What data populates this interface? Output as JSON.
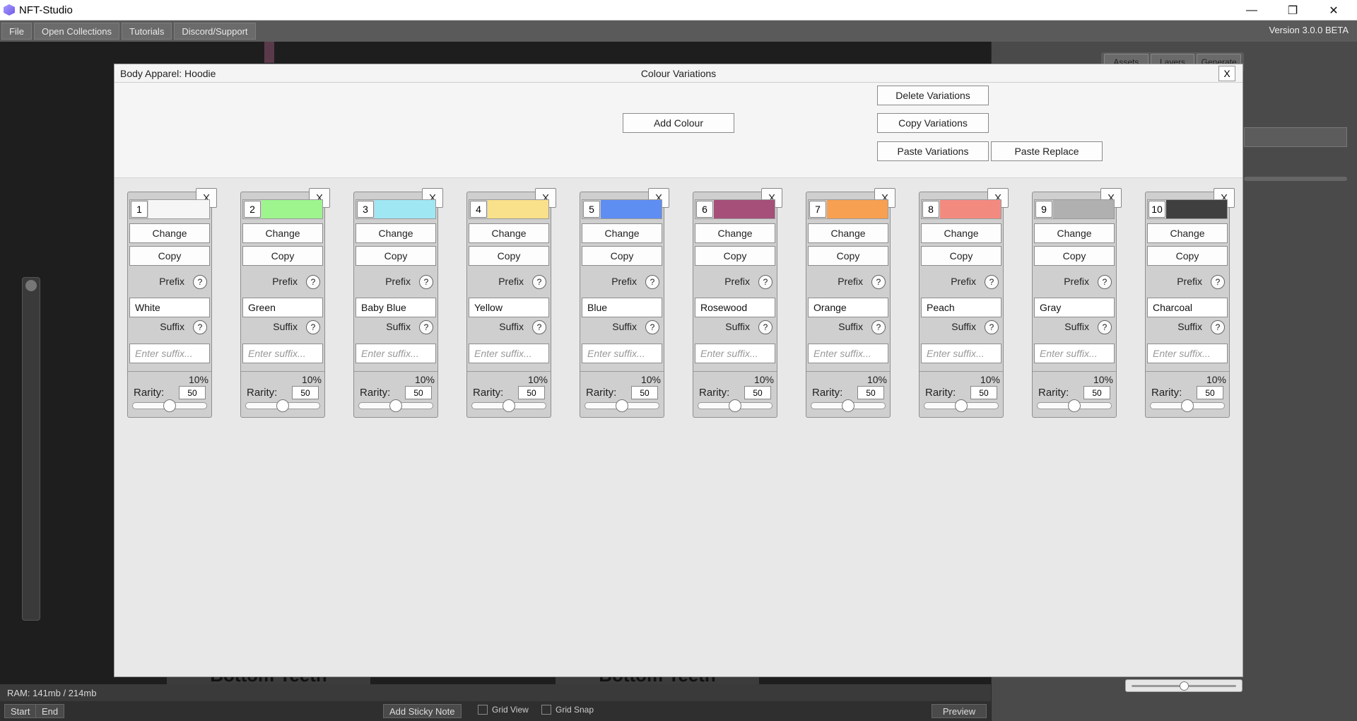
{
  "window": {
    "title": "NFT-Studio",
    "minimize": "—",
    "restore": "❐",
    "close": "✕"
  },
  "menu": {
    "items": [
      "File",
      "Open Collections",
      "Tutorials",
      "Discord/Support"
    ],
    "version": "Version 3.0.0 BETA"
  },
  "right_panel": {
    "tabs": [
      "Assets",
      "Layers",
      "Generate"
    ]
  },
  "workspace": {
    "layer_labels": [
      "Bottom Teeth",
      "Bottom Teeth"
    ]
  },
  "status": {
    "ram": "RAM: 141mb / 214mb"
  },
  "bottom_bar": {
    "start": "Start",
    "end": "End",
    "add_sticky_note": "Add Sticky Note",
    "grid_view": "Grid View",
    "grid_snap": "Grid Snap",
    "preview": "Preview"
  },
  "modal": {
    "layer_name": "Body Apparel: Hoodie",
    "title": "Colour Variations",
    "close": "X",
    "add_colour": "Add Colour",
    "delete_variations": "Delete Variations",
    "copy_variations": "Copy Variations",
    "paste_variations": "Paste Variations",
    "paste_replace": "Paste Replace"
  },
  "card_labels": {
    "change": "Change",
    "copy": "Copy",
    "prefix": "Prefix",
    "suffix": "Suffix",
    "help": "?",
    "rarity": "Rarity:",
    "remove": "X",
    "suffix_placeholder": "Enter suffix..."
  },
  "variations": [
    {
      "number": "1",
      "color": "#f6f6f6",
      "prefix": "White",
      "suffix": "",
      "percent": "10%",
      "rarity": "50",
      "slider_level": 0.5
    },
    {
      "number": "2",
      "color": "#9ef58e",
      "prefix": "Green",
      "suffix": "",
      "percent": "10%",
      "rarity": "50",
      "slider_level": 0.5
    },
    {
      "number": "3",
      "color": "#a0e7f4",
      "prefix": "Baby Blue",
      "suffix": "",
      "percent": "10%",
      "rarity": "50",
      "slider_level": 0.5
    },
    {
      "number": "4",
      "color": "#f9e08a",
      "prefix": "Yellow",
      "suffix": "",
      "percent": "10%",
      "rarity": "50",
      "slider_level": 0.5
    },
    {
      "number": "5",
      "color": "#5f8ef2",
      "prefix": "Blue",
      "suffix": "",
      "percent": "10%",
      "rarity": "50",
      "slider_level": 0.5
    },
    {
      "number": "6",
      "color": "#a54f79",
      "prefix": "Rosewood",
      "suffix": "",
      "percent": "10%",
      "rarity": "50",
      "slider_level": 0.5
    },
    {
      "number": "7",
      "color": "#f7a052",
      "prefix": "Orange",
      "suffix": "",
      "percent": "10%",
      "rarity": "50",
      "slider_level": 0.5
    },
    {
      "number": "8",
      "color": "#f38a80",
      "prefix": "Peach",
      "suffix": "",
      "percent": "10%",
      "rarity": "50",
      "slider_level": 0.5
    },
    {
      "number": "9",
      "color": "#b0b0b0",
      "prefix": "Gray",
      "suffix": "",
      "percent": "10%",
      "rarity": "50",
      "slider_level": 0.5
    },
    {
      "number": "10",
      "color": "#3f3f3f",
      "prefix": "Charcoal",
      "suffix": "",
      "percent": "10%",
      "rarity": "50",
      "slider_level": 0.5
    }
  ],
  "zoom_slider_level": 0.5
}
